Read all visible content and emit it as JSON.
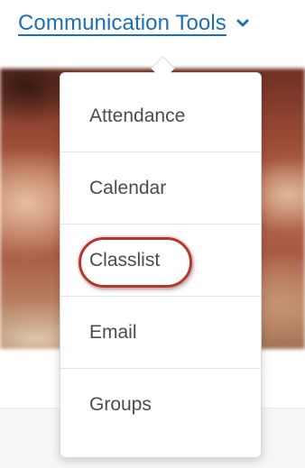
{
  "nav": {
    "label": "Communication Tools",
    "icon": "chevron-down-icon"
  },
  "colors": {
    "link": "#1d6fb3",
    "menu_text": "#494c4e",
    "highlight": "#b5372c"
  },
  "menu": {
    "items": [
      {
        "label": "Attendance"
      },
      {
        "label": "Calendar"
      },
      {
        "label": "Classlist",
        "highlighted": true
      },
      {
        "label": "Email"
      },
      {
        "label": "Groups"
      }
    ]
  }
}
